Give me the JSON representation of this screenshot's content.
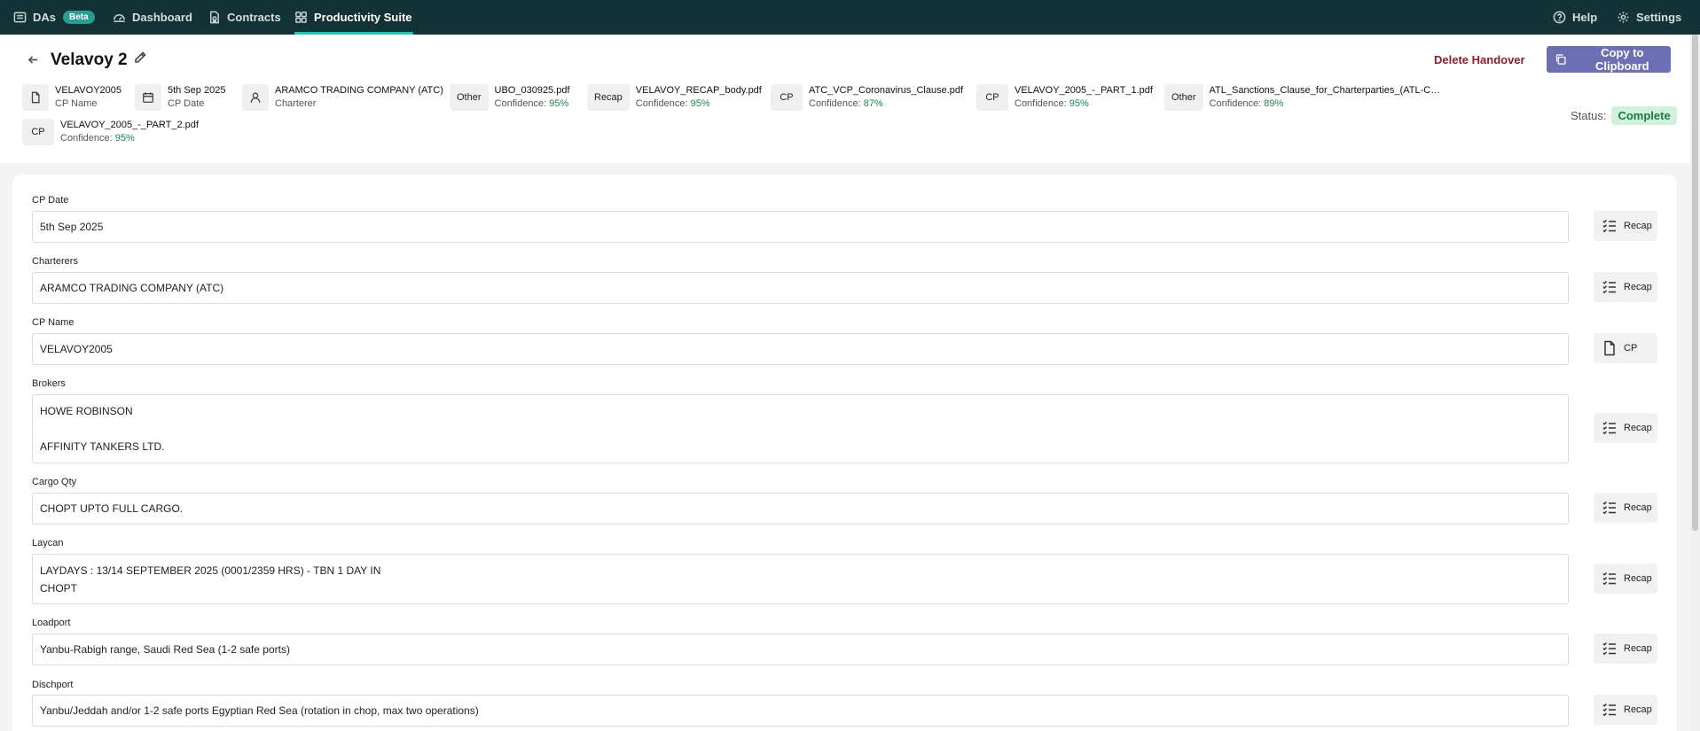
{
  "nav": {
    "das_label": "DAs",
    "beta_label": "Beta",
    "dashboard_label": "Dashboard",
    "contracts_label": "Contracts",
    "productivity_label": "Productivity Suite",
    "help_label": "Help",
    "settings_label": "Settings",
    "active_tab": "Productivity Suite"
  },
  "header": {
    "title": "Velavoy 2",
    "delete_label": "Delete Handover",
    "copy_label": "Copy to Clipboard",
    "status_label": "Status:",
    "status_value": "Complete"
  },
  "meta": {
    "cp_name": {
      "value": "VELAVOY2005",
      "label": "CP Name",
      "icon": "document-icon"
    },
    "cp_date": {
      "value": "5th Sep 2025",
      "label": "CP Date",
      "icon": "calendar-icon"
    },
    "charterer": {
      "value": "ARAMCO TRADING COMPANY (ATC)",
      "label": "Charterer",
      "icon": "user-icon"
    }
  },
  "documents": [
    {
      "tag": "Other",
      "name": "UBO_030925.pdf",
      "conf_label": "Confidence:",
      "confidence": "95%"
    },
    {
      "tag": "Recap",
      "name": "VELAVOY_RECAP_body.pdf",
      "conf_label": "Confidence:",
      "confidence": "95%"
    },
    {
      "tag": "CP",
      "name": "ATC_VCP_Coronavirus_Clause.pdf",
      "conf_label": "Confidence:",
      "confidence": "87%"
    },
    {
      "tag": "CP",
      "name": "VELAVOY_2005_-_PART_1.pdf",
      "conf_label": "Confidence:",
      "confidence": "95%"
    },
    {
      "tag": "Other",
      "name": "ATL_Sanctions_Clause_for_Charterparties_(ATL-Chart...",
      "conf_label": "Confidence:",
      "confidence": "89%"
    },
    {
      "tag": "CP",
      "name": "VELAVOY_2005_-_PART_2.pdf",
      "conf_label": "Confidence:",
      "confidence": "95%"
    }
  ],
  "fields": [
    {
      "label": "CP Date",
      "lines": [
        "5th Sep 2025"
      ],
      "source": "Recap",
      "source_icon": "list-icon"
    },
    {
      "label": "Charterers",
      "lines": [
        "ARAMCO TRADING COMPANY (ATC)"
      ],
      "source": "Recap",
      "source_icon": "list-icon"
    },
    {
      "label": "CP Name",
      "lines": [
        "VELAVOY2005"
      ],
      "source": "CP",
      "source_icon": "document-icon"
    },
    {
      "label": "Brokers",
      "lines": [
        "HOWE ROBINSON",
        "",
        "AFFINITY TANKERS LTD."
      ],
      "source": "Recap",
      "source_icon": "list-icon"
    },
    {
      "label": "Cargo Qty",
      "lines": [
        "CHOPT UPTO FULL CARGO."
      ],
      "source": "Recap",
      "source_icon": "list-icon"
    },
    {
      "label": "Laycan",
      "lines": [
        "LAYDAYS : 13/14 SEPTEMBER 2025 (0001/2359 HRS) - TBN 1 DAY IN",
        "CHOPT"
      ],
      "source": "Recap",
      "source_icon": "list-icon"
    },
    {
      "label": "Loadport",
      "lines": [
        "Yanbu-Rabigh range, Saudi Red Sea (1-2 safe ports)"
      ],
      "source": "Recap",
      "source_icon": "list-icon"
    },
    {
      "label": "Dischport",
      "lines": [
        "Yanbu/Jeddah and/or 1-2 safe ports Egyptian Red Sea (rotation in chop, max two operations)"
      ],
      "source": "Recap",
      "source_icon": "list-icon"
    }
  ],
  "colors": {
    "nav_bg": "#133235",
    "nav_active_underline": "#2bbeb6",
    "accent_button": "#6c6fb4",
    "delete_text": "#8b1e2a",
    "confidence_green": "#1f8a4c",
    "status_bg": "#d2f1dc"
  }
}
